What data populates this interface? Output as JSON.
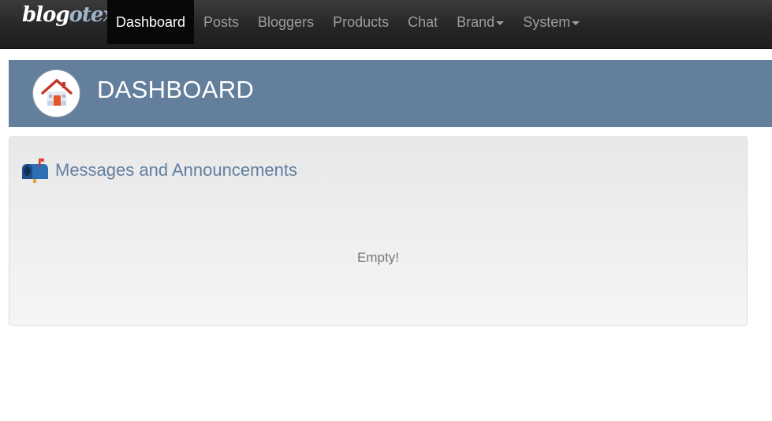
{
  "navbar": {
    "brand": {
      "part1": "blog",
      "part2": "otex"
    },
    "items": [
      {
        "label": "Dashboard",
        "active": true,
        "dropdown": false
      },
      {
        "label": "Posts",
        "active": false,
        "dropdown": false
      },
      {
        "label": "Bloggers",
        "active": false,
        "dropdown": false
      },
      {
        "label": "Products",
        "active": false,
        "dropdown": false
      },
      {
        "label": "Chat",
        "active": false,
        "dropdown": false
      },
      {
        "label": "Brand",
        "active": false,
        "dropdown": true
      },
      {
        "label": "System",
        "active": false,
        "dropdown": true
      }
    ]
  },
  "header": {
    "title": "DASHBOARD",
    "icon": "home-icon"
  },
  "messages": {
    "title": "Messages and Announcements",
    "icon": "mailbox-icon",
    "empty_text": "Empty!"
  },
  "colors": {
    "navbar_bg": "#262626",
    "header_bg": "#647f9c",
    "panel_title": "#5f7fa0",
    "nav_text": "#9d9d9d",
    "nav_active_bg": "#080808"
  }
}
